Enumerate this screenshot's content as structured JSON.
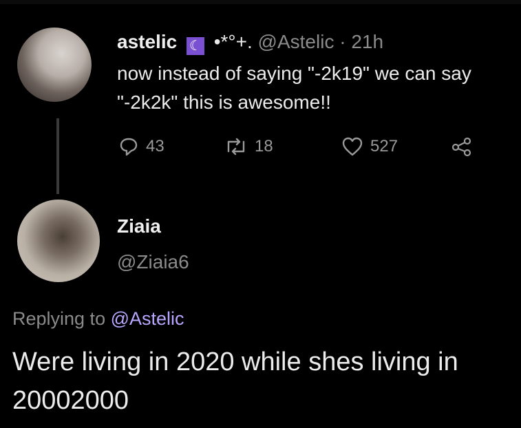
{
  "tweet": {
    "display_name": "astelic",
    "moon_icon_char": "☾",
    "sparkles": "•*°+.",
    "handle": "@Astelic",
    "time": "· 21h",
    "text": "now instead of saying \"-2k19\" we can say \"-2k2k\" this is awesome!!",
    "replies": "43",
    "retweets": "18",
    "likes": "527"
  },
  "reply": {
    "display_name": "Ziaia",
    "handle": "@Ziaia6",
    "replying_prefix": "Replying to",
    "replying_handle": "@Astelic",
    "text": "Were living in 2020 while shes living in 20002000"
  },
  "colors": {
    "background": "#000000",
    "accent_link": "#b9a6ff",
    "moon_badge": "#7a4fd1"
  }
}
